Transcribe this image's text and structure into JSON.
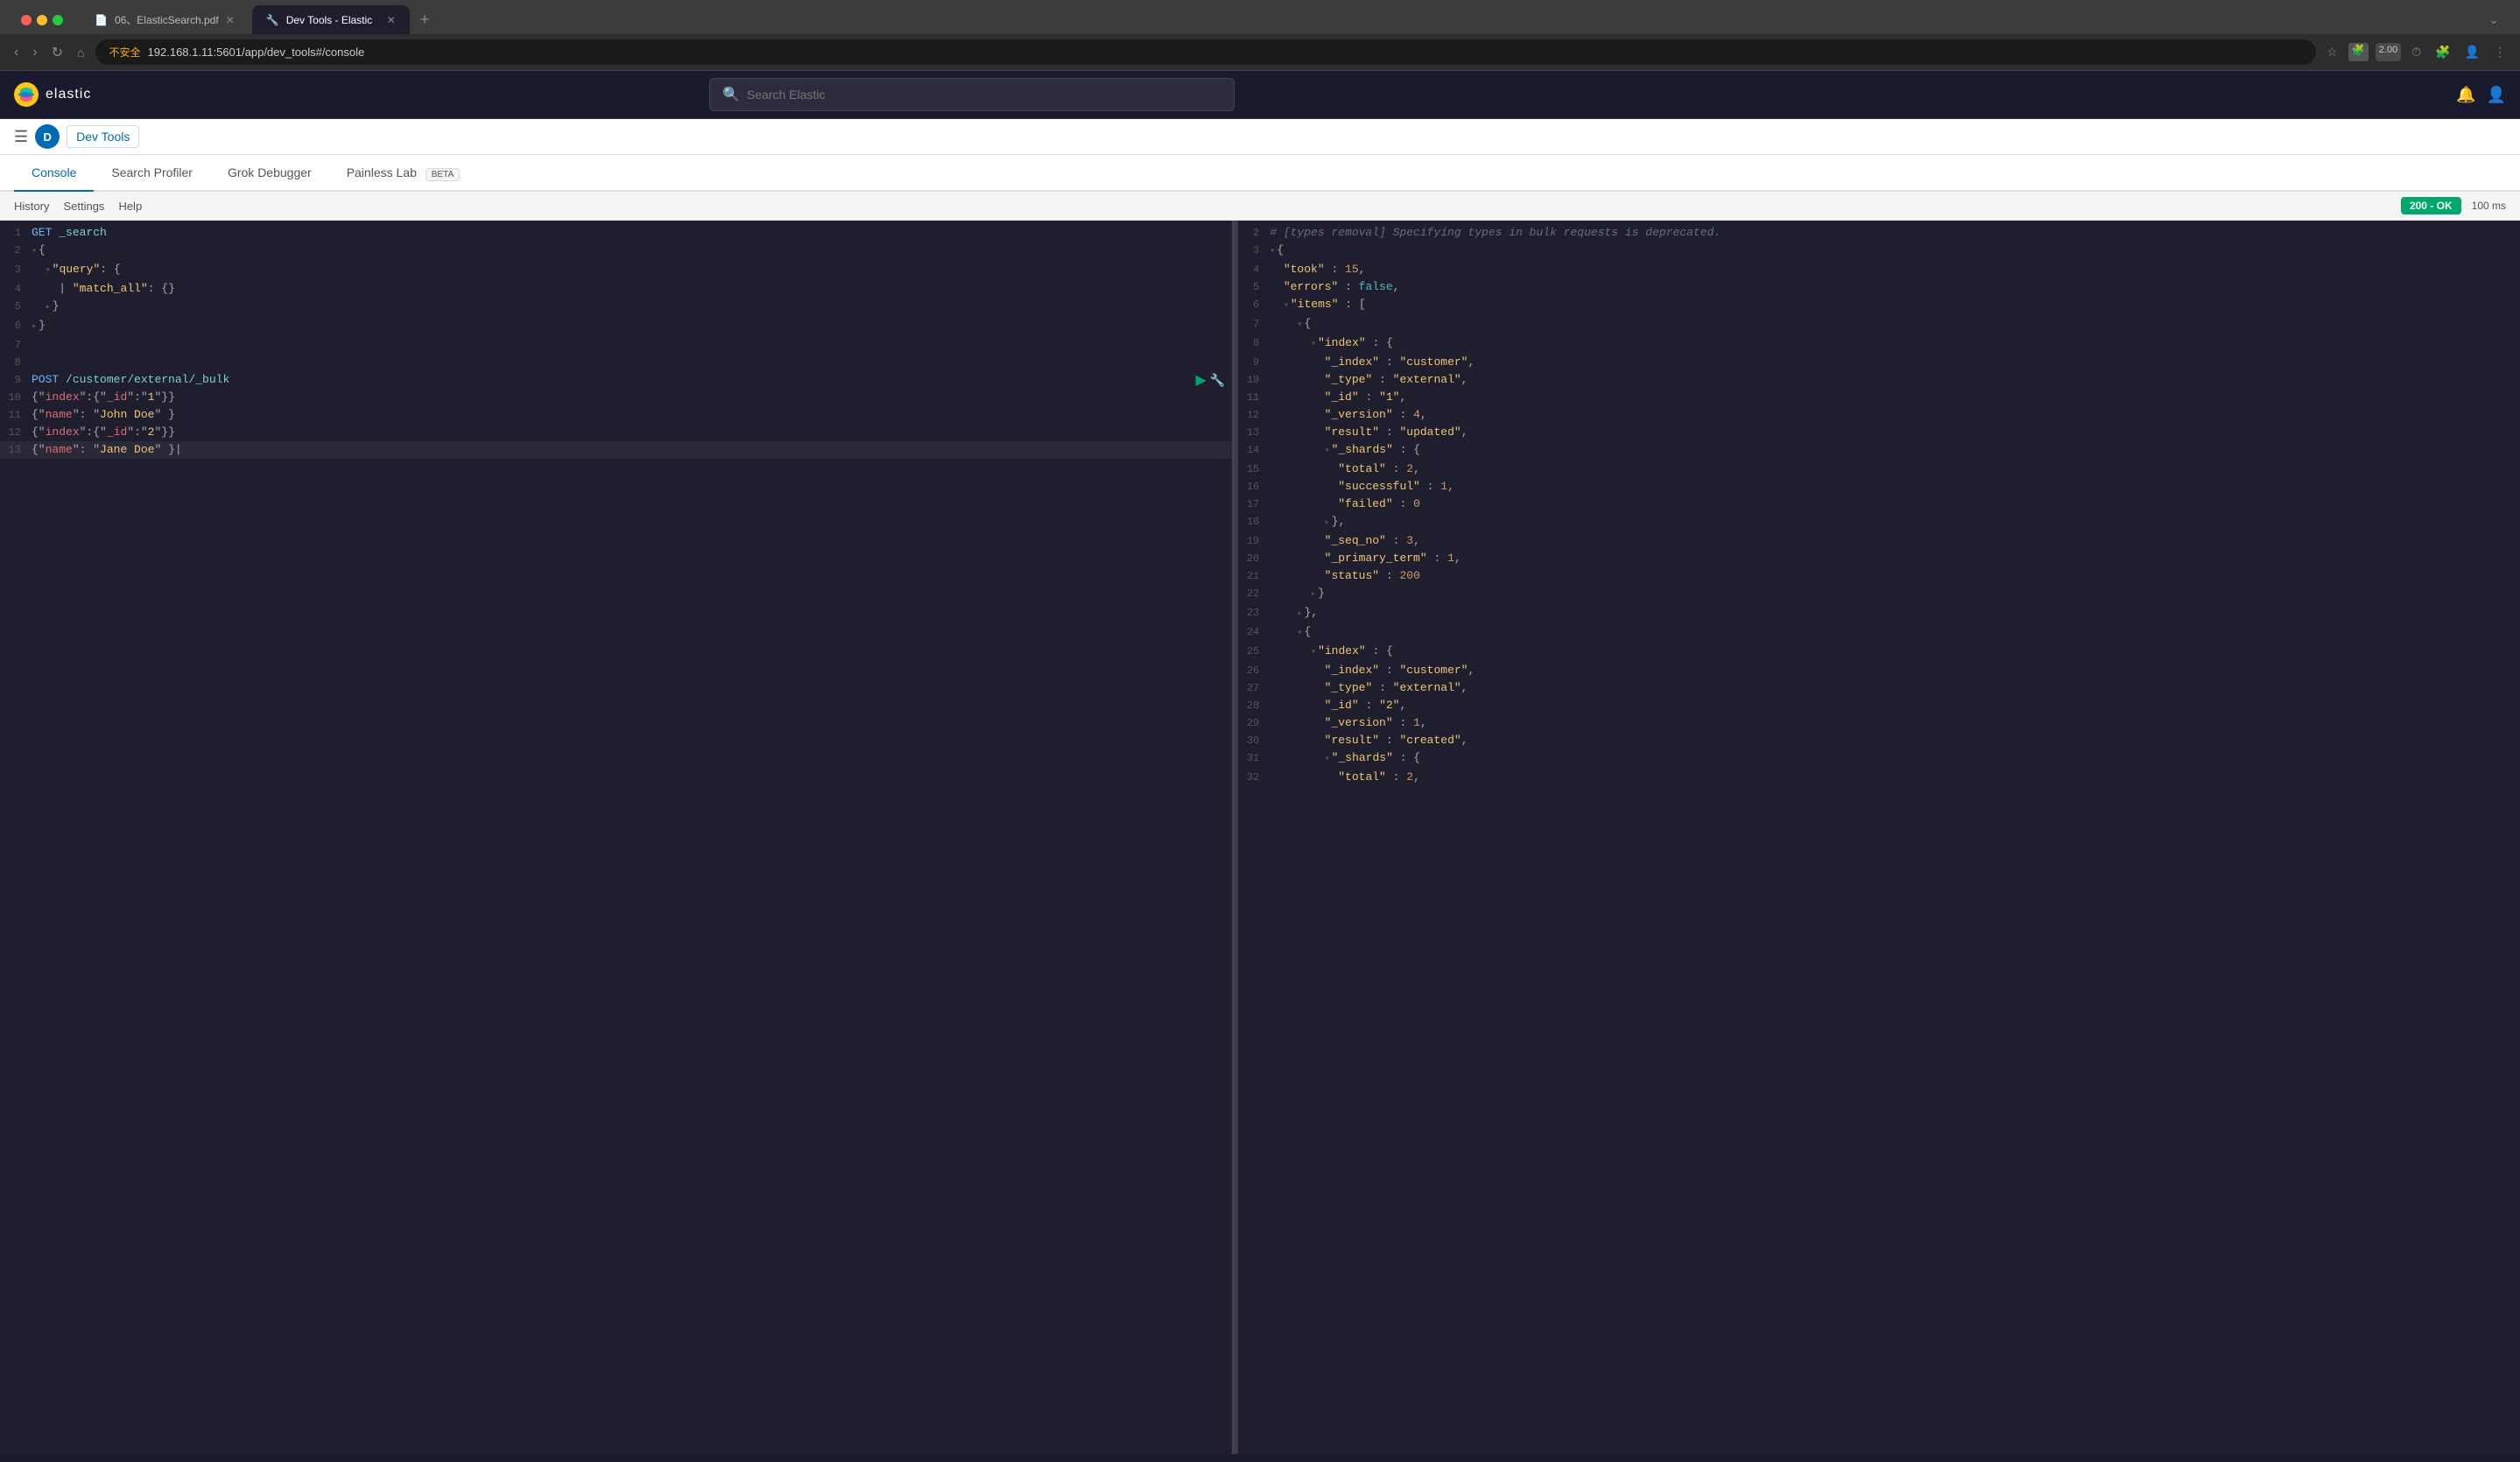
{
  "browser": {
    "tabs": [
      {
        "id": "tab1",
        "title": "06、ElasticSearch.pdf",
        "active": false,
        "favicon": "📄"
      },
      {
        "id": "tab2",
        "title": "Dev Tools - Elastic",
        "active": true,
        "favicon": "🔧"
      }
    ],
    "url": "192.168.1.11:5601/app/dev_tools#/console",
    "security_warning": "不安全"
  },
  "app": {
    "logo_text": "elastic",
    "search_placeholder": "Search Elastic",
    "toolbar": {
      "app_badge": "D",
      "app_title": "Dev Tools"
    }
  },
  "devtools": {
    "tabs": [
      {
        "id": "console",
        "label": "Console",
        "active": true,
        "beta": false
      },
      {
        "id": "search-profiler",
        "label": "Search Profiler",
        "active": false,
        "beta": false
      },
      {
        "id": "grok-debugger",
        "label": "Grok Debugger",
        "active": false,
        "beta": false
      },
      {
        "id": "painless-lab",
        "label": "Painless Lab",
        "active": false,
        "beta": true
      }
    ],
    "toolbar": {
      "history": "History",
      "settings": "Settings",
      "help": "Help",
      "status": "200 - OK",
      "time": "100 ms"
    }
  },
  "editor": {
    "left_lines": [
      {
        "num": "1",
        "content": "GET _search",
        "type": "request"
      },
      {
        "num": "2",
        "content": "{",
        "type": "code"
      },
      {
        "num": "3",
        "content": "  \"query\": {",
        "type": "code"
      },
      {
        "num": "4",
        "content": "    \"match_all\": {}",
        "type": "code"
      },
      {
        "num": "5",
        "content": "  }",
        "type": "code"
      },
      {
        "num": "6",
        "content": "}",
        "type": "code"
      },
      {
        "num": "7",
        "content": "",
        "type": "code"
      },
      {
        "num": "8",
        "content": "",
        "type": "code"
      },
      {
        "num": "9",
        "content": "POST /customer/external/_bulk",
        "type": "request"
      },
      {
        "num": "10",
        "content": "{\"index\":{\"_id\":\"1\"}}",
        "type": "code"
      },
      {
        "num": "11",
        "content": "{\"name\": \"John Doe\" }",
        "type": "code"
      },
      {
        "num": "12",
        "content": "{\"index\":{\"_id\":\"2\"}}",
        "type": "code"
      },
      {
        "num": "13",
        "content": "{\"name\": \"Jane Doe\" }",
        "type": "code"
      }
    ],
    "right_lines": [
      {
        "num": "2",
        "content": "# [types removal] Specifying types in bulk requests is deprecated.",
        "type": "comment"
      },
      {
        "num": "3",
        "content": "{",
        "type": "code"
      },
      {
        "num": "4",
        "content": "  \"took\" : 15,",
        "type": "code"
      },
      {
        "num": "5",
        "content": "  \"errors\" : false,",
        "type": "code"
      },
      {
        "num": "6",
        "content": "  \"items\" : [",
        "type": "code"
      },
      {
        "num": "7",
        "content": "    {",
        "type": "code"
      },
      {
        "num": "8",
        "content": "      \"index\" : {",
        "type": "code"
      },
      {
        "num": "9",
        "content": "        \"_index\" : \"customer\",",
        "type": "code"
      },
      {
        "num": "10",
        "content": "        \"_type\" : \"external\",",
        "type": "code"
      },
      {
        "num": "11",
        "content": "        \"_id\" : \"1\",",
        "type": "code"
      },
      {
        "num": "12",
        "content": "        \"_version\" : 4,",
        "type": "code"
      },
      {
        "num": "13",
        "content": "        \"result\" : \"updated\",",
        "type": "code"
      },
      {
        "num": "14",
        "content": "        \"_shards\" : {",
        "type": "code"
      },
      {
        "num": "15",
        "content": "          \"total\" : 2,",
        "type": "code"
      },
      {
        "num": "16",
        "content": "          \"successful\" : 1,",
        "type": "code"
      },
      {
        "num": "17",
        "content": "          \"failed\" : 0",
        "type": "code"
      },
      {
        "num": "18",
        "content": "        },",
        "type": "code"
      },
      {
        "num": "19",
        "content": "        \"_seq_no\" : 3,",
        "type": "code"
      },
      {
        "num": "20",
        "content": "        \"_primary_term\" : 1,",
        "type": "code"
      },
      {
        "num": "21",
        "content": "        \"status\" : 200",
        "type": "code"
      },
      {
        "num": "22",
        "content": "      }",
        "type": "code"
      },
      {
        "num": "23",
        "content": "    },",
        "type": "code"
      },
      {
        "num": "24",
        "content": "    {",
        "type": "code"
      },
      {
        "num": "25",
        "content": "      \"index\" : {",
        "type": "code"
      },
      {
        "num": "26",
        "content": "        \"_index\" : \"customer\",",
        "type": "code"
      },
      {
        "num": "27",
        "content": "        \"_type\" : \"external\",",
        "type": "code"
      },
      {
        "num": "28",
        "content": "        \"_id\" : \"2\",",
        "type": "code"
      },
      {
        "num": "29",
        "content": "        \"_version\" : 1,",
        "type": "code"
      },
      {
        "num": "30",
        "content": "        \"result\" : \"created\",",
        "type": "code"
      },
      {
        "num": "31",
        "content": "        \"_shards\" : {",
        "type": "code"
      },
      {
        "num": "32",
        "content": "          \"total\" : 2,",
        "type": "code"
      }
    ]
  }
}
